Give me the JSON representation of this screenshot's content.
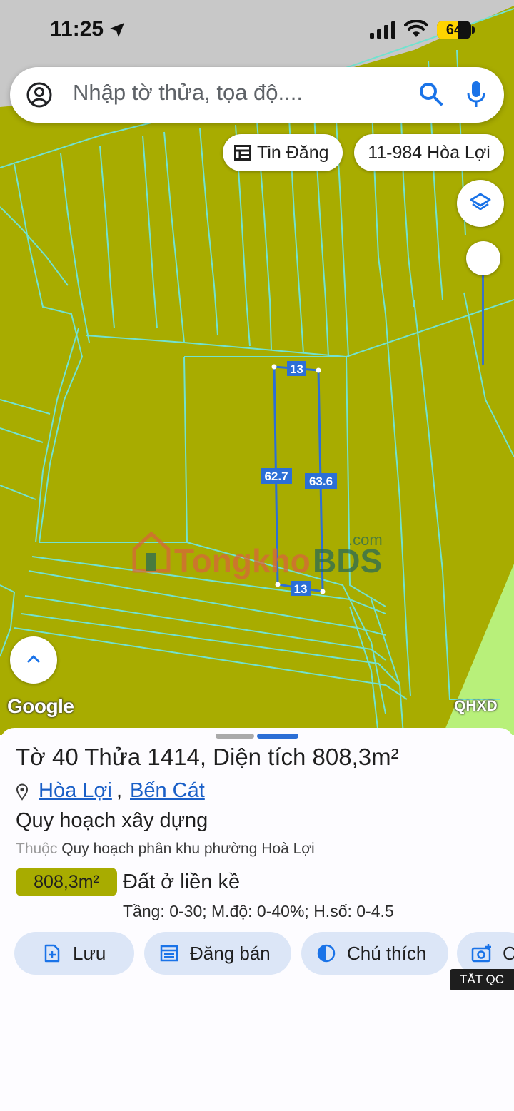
{
  "status_bar": {
    "time": "11:25",
    "battery": "64"
  },
  "search": {
    "placeholder": "Nhập tờ thửa, tọa độ...."
  },
  "chips": {
    "listings": "Tin Đăng",
    "area_tag": "11-984 Hòa Lợi"
  },
  "map": {
    "edge_labels": {
      "top": "13",
      "left": "62.7",
      "right": "63.6",
      "bottom": "13"
    },
    "watermark": "TongkhoBDS.com",
    "google_logo": "Google",
    "layer_code": "QHXD",
    "colors": {
      "land": "#a8ac00",
      "parcel_lines": "#6fe0d0",
      "selection": "#2c6fd6",
      "edge_label_bg": "#2c6fd6"
    }
  },
  "sheet": {
    "title_prefix": "Tờ ",
    "sheet_no": "40",
    "plot_label": " Thửa ",
    "plot_no": "1414",
    "area_label": ", Diện tích ",
    "area_value": "808,3m²",
    "ward": "Hòa Lợi",
    "district": "Bến Cát",
    "zone_title": "Quy hoạch xây dựng",
    "belongs_label": "Thuộc",
    "belongs_plan": "Quy hoạch phân khu phường Hoà Lợi",
    "badge_area": "808,3m²",
    "land_type": "Đất ở liền kề",
    "limits": "Tầng: 0-30; M.độ: 0-40%; H.số: 0-4.5"
  },
  "actions": {
    "save": "Lưu",
    "post_sale": "Đăng bán",
    "legend": "Chú thích",
    "capture": "C"
  },
  "ad_tag": "TẮT QC"
}
